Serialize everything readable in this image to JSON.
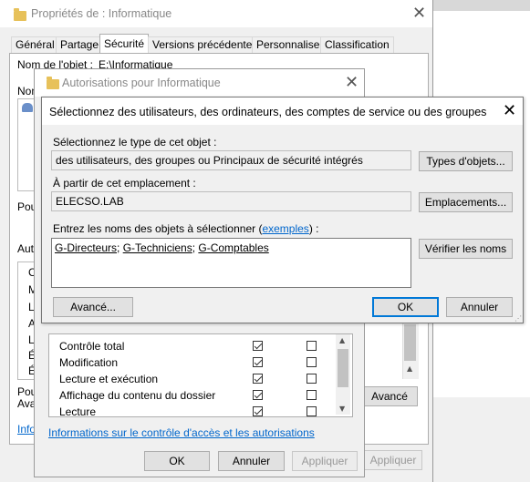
{
  "props": {
    "title": "Propriétés de : Informatique",
    "tabs": [
      "Général",
      "Partage",
      "Sécurité",
      "Versions précédentes",
      "Personnaliser",
      "Classification"
    ],
    "object_name_label": "Nom de l'objet :",
    "object_name_value": "E:\\Informatique",
    "partial_labels": [
      "Nom",
      "Pou",
      "Auto",
      "Pou",
      "Ava"
    ],
    "list_partial": [
      "C",
      "M",
      "L",
      "A",
      "L",
      "É",
      "É"
    ],
    "link_partial": "Info",
    "advanced_button": "Avancé",
    "apply_button": "Appliquer"
  },
  "auth": {
    "title": "Autorisations pour Informatique",
    "permissions": [
      {
        "label": "Contrôle total",
        "allow": true,
        "deny": false
      },
      {
        "label": "Modification",
        "allow": true,
        "deny": false
      },
      {
        "label": "Lecture et exécution",
        "allow": true,
        "deny": false
      },
      {
        "label": "Affichage du contenu du dossier",
        "allow": true,
        "deny": false
      },
      {
        "label": "Lecture",
        "allow": true,
        "deny": false
      }
    ],
    "link": "Informations sur le contrôle d'accès et les autorisations",
    "ok": "OK",
    "cancel": "Annuler",
    "apply": "Appliquer"
  },
  "select": {
    "title": "Sélectionnez des utilisateurs, des ordinateurs, des comptes de service ou des groupes",
    "type_label": "Sélectionnez le type de cet objet :",
    "type_value": "des utilisateurs, des groupes ou Principaux de sécurité intégrés",
    "type_button": "Types d'objets...",
    "location_label": "À partir de cet emplacement :",
    "location_value": "ELECSO.LAB",
    "location_button": "Emplacements...",
    "names_label_pre": "Entrez les noms des objets à sélectionner (",
    "names_label_link": "exemples",
    "names_label_post": ") :",
    "names": [
      "G-Directeurs",
      "G-Techniciens",
      "G-Comptables"
    ],
    "check_button": "Vérifier les noms",
    "advanced_button": "Avancé...",
    "ok": "OK",
    "cancel": "Annuler"
  }
}
